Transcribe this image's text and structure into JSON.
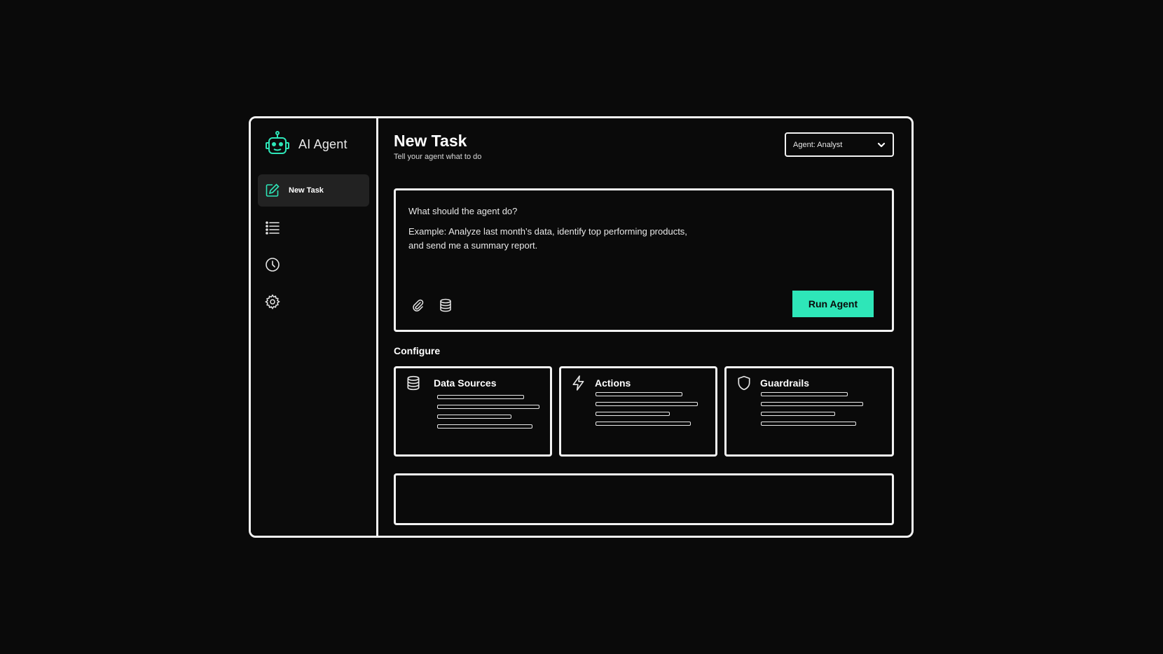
{
  "brand": {
    "name": "AI Agent",
    "icon": "robot-icon",
    "accent": "#2ee6b8"
  },
  "sidebar": {
    "items": [
      {
        "label": "New Task",
        "icon": "edit-icon",
        "active": true
      },
      {
        "label": "",
        "icon": "list-icon",
        "active": false
      },
      {
        "label": "",
        "icon": "clock-icon",
        "active": false
      },
      {
        "label": "",
        "icon": "gear-icon",
        "active": false
      }
    ]
  },
  "header": {
    "title": "New Task",
    "subtitle": "Tell your agent what to do",
    "agent_select": "Agent: Analyst"
  },
  "prompt": {
    "question": "What should the agent do?",
    "example": "Example: Analyze last month’s data, identify top performing products, and send me a summary report.",
    "tools": [
      "paperclip-icon",
      "database-icon"
    ],
    "run_label": "Run Agent"
  },
  "configure": {
    "label": "Configure",
    "cards": [
      {
        "title": "Data Sources",
        "icon": "database-icon"
      },
      {
        "title": "Actions",
        "icon": "lightning-icon"
      },
      {
        "title": "Guardrails",
        "icon": "shield-icon"
      }
    ]
  },
  "colors": {
    "background": "#0a0a0a",
    "border": "#f2f2f2",
    "accent": "#2ee6b8",
    "active_nav": "#222222"
  }
}
